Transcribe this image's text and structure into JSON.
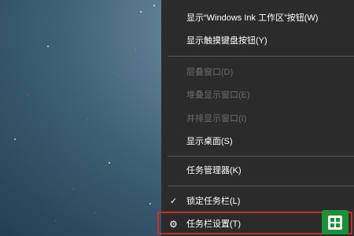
{
  "context_menu": {
    "items": [
      {
        "label": "显示“Windows Ink 工作区”按钮(W)",
        "enabled": true
      },
      {
        "label": "显示触摸键盘按钮(Y)",
        "enabled": true
      },
      {
        "label": "层叠窗口(D)",
        "enabled": false
      },
      {
        "label": "堆叠显示窗口(E)",
        "enabled": false
      },
      {
        "label": "并排显示窗口(I)",
        "enabled": false
      },
      {
        "label": "显示桌面(S)",
        "enabled": true
      },
      {
        "label": "任务管理器(K)",
        "enabled": true
      },
      {
        "label": "锁定任务栏(L)",
        "enabled": true,
        "checked": true
      },
      {
        "label": "任务栏设置(T)",
        "enabled": true,
        "icon": "gear-icon",
        "highlighted": true
      }
    ]
  },
  "colors": {
    "menu_background": "#2b2b2b",
    "menu_text": "#ffffff",
    "disabled_text": "#6d6d6d",
    "highlight_border": "#c42f2f",
    "badge": "#1f8f3a"
  },
  "icons": {
    "check": "checkmark-icon",
    "settings": "gear-icon",
    "badge": "windows-logo-badge-icon"
  }
}
